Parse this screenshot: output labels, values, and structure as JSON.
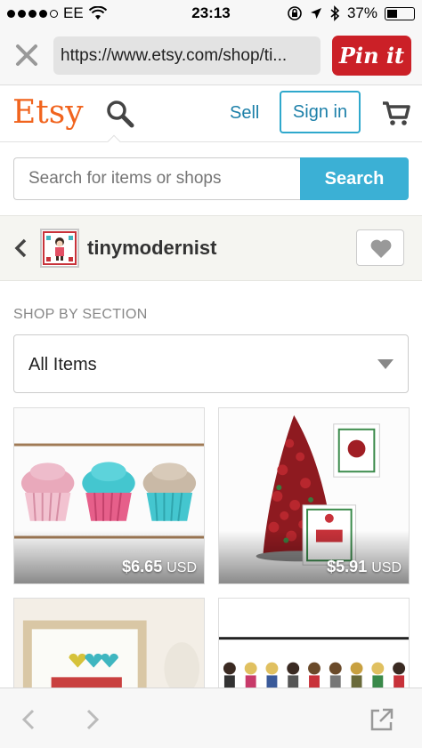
{
  "status_bar": {
    "carrier": "EE",
    "time": "23:13",
    "battery": "37%"
  },
  "browser": {
    "url": "https://www.etsy.com/shop/ti...",
    "pinit_label": "Pin it"
  },
  "header": {
    "logo": "Etsy",
    "sell_label": "Sell",
    "signin_label": "Sign in"
  },
  "search": {
    "placeholder": "Search for items or shops",
    "button_label": "Search"
  },
  "shop": {
    "name": "tinymodernist"
  },
  "sections": {
    "label": "SHOP BY SECTION",
    "selected": "All Items"
  },
  "listings": [
    {
      "price": "$6.65",
      "currency": "USD",
      "title": "",
      "colors": [
        "#e9a9bb",
        "#44c6cf",
        "#c9b9a6"
      ]
    },
    {
      "price": "$5.91",
      "currency": "USD",
      "title": "",
      "colors": [
        "#a01e24",
        "#3a8a4a"
      ]
    },
    {
      "price": "",
      "currency": "",
      "title": ""
    },
    {
      "price": "",
      "currency": "",
      "title": ""
    }
  ],
  "colors": {
    "etsy_orange": "#f1641e",
    "link_blue": "#1d80a9",
    "search_blue": "#3bb0d5",
    "pinterest_red": "#cb2027"
  }
}
